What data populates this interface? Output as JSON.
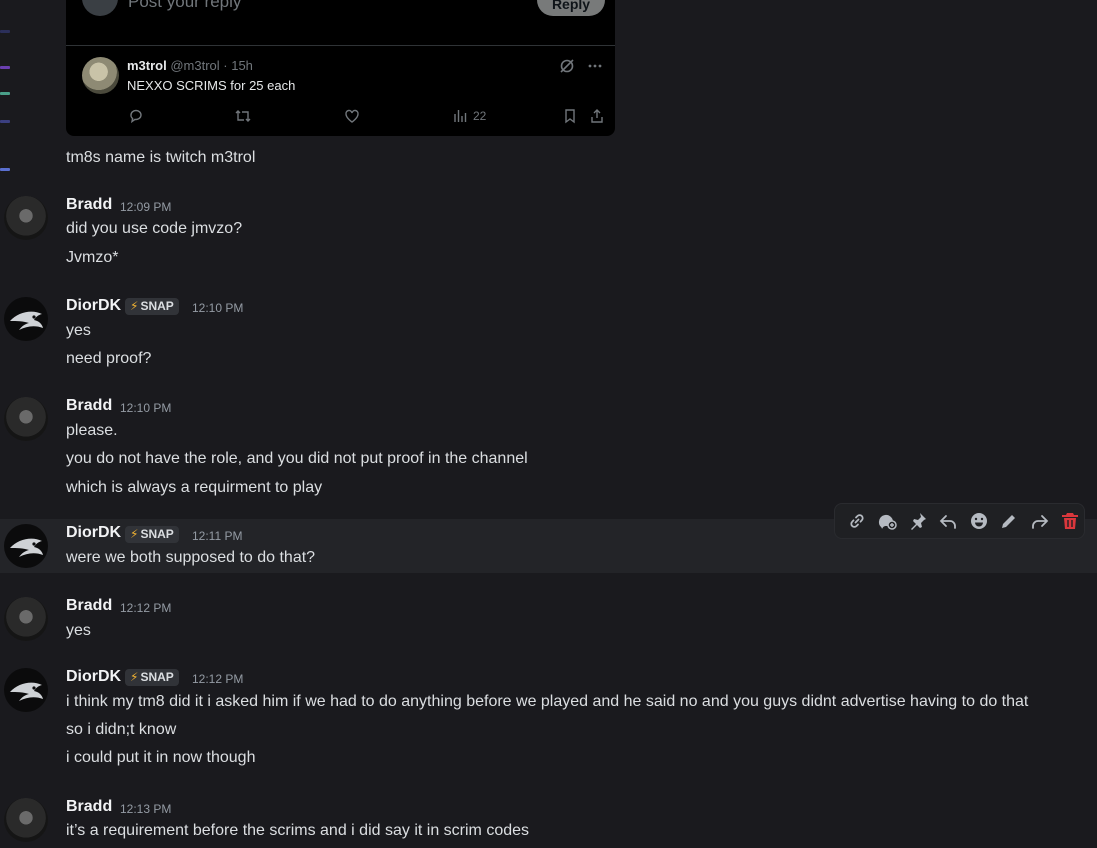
{
  "tweet": {
    "reply_placeholder": "Post your reply",
    "reply_button": "Reply",
    "author_name": "m3trol",
    "author_meta": "@m3trol · 15h",
    "text": "NEXXO SCRIMS for 25 each",
    "views": "22",
    "icons": [
      "grok-icon",
      "more-icon",
      "reply-icon",
      "retweet-icon",
      "like-icon",
      "views-icon",
      "bookmark-icon",
      "share-icon"
    ]
  },
  "standalone_line": "tm8s name is twitch m3trol",
  "badge_label": "SNAP",
  "messages": [
    {
      "author": "Bradd",
      "time": "12:09 PM",
      "lines": [
        "did you use code jmvzo?",
        "Jvmzo*"
      ]
    },
    {
      "author": "DiorDK",
      "time": "12:10 PM",
      "lines": [
        "yes",
        "need proof?"
      ]
    },
    {
      "author": "Bradd",
      "time": "12:10 PM",
      "lines": [
        "please.",
        "you do not have the role, and you did not put proof in the channel",
        "which is always a requirment to play"
      ]
    },
    {
      "author": "DiorDK",
      "time": "12:11 PM",
      "lines": [
        "were we both supposed to do that?"
      ]
    },
    {
      "author": "Bradd",
      "time": "12:12 PM",
      "lines": [
        "yes"
      ]
    },
    {
      "author": "DiorDK",
      "time": "12:12 PM",
      "lines": [
        "i think my tm8 did it i asked him if we had to do anything before we played and he said no and you guys didnt advertise having to do that",
        "so i didn;t know",
        "i could put it in now though"
      ]
    },
    {
      "author": "Bradd",
      "time": "12:13 PM",
      "lines": [
        "it’s a requirement before the scrims and i did say it in scrim codes"
      ]
    }
  ],
  "toolbar_icons": [
    "copy-link-icon",
    "add-reaction-icon",
    "pin-icon",
    "reply-icon",
    "emoji-icon",
    "edit-icon",
    "forward-icon",
    "delete-icon"
  ],
  "colors": {
    "background": "#1a1a1e",
    "hover_row": "#232428",
    "delete_red": "#da373c",
    "bolt": "#f0b232"
  }
}
